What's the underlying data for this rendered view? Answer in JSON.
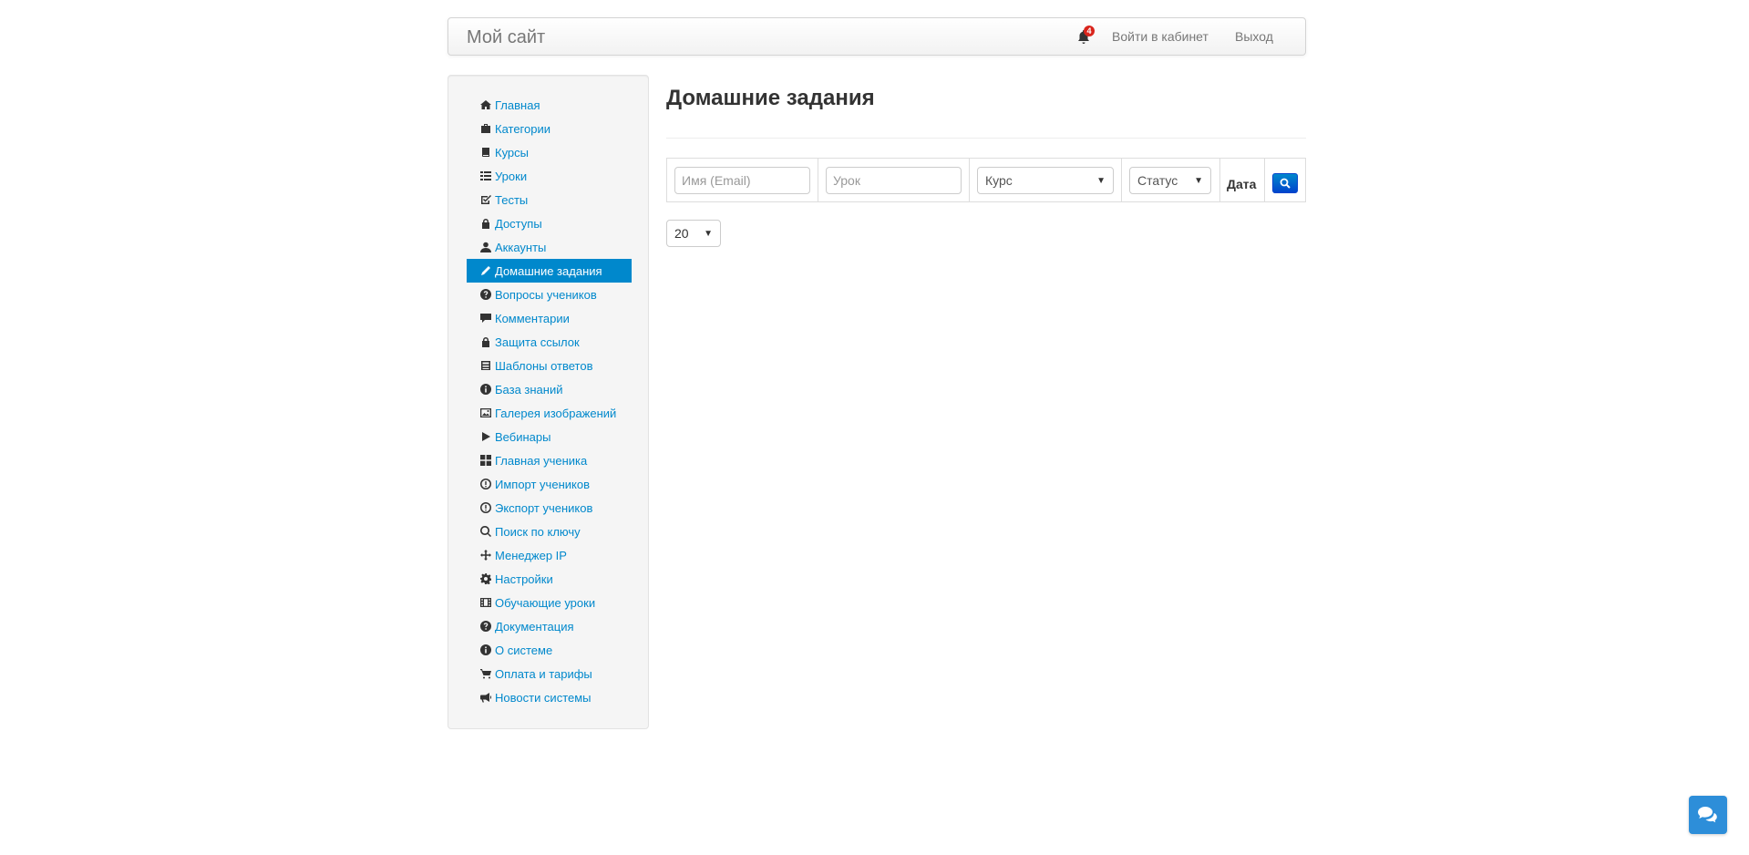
{
  "navbar": {
    "brand": "Мой сайт",
    "notifications_count": "4",
    "login_label": "Войти в кабинет",
    "logout_label": "Выход"
  },
  "sidebar": {
    "items": [
      {
        "label": "Главная",
        "icon": "home-icon"
      },
      {
        "label": "Категории",
        "icon": "briefcase-icon"
      },
      {
        "label": "Курсы",
        "icon": "book-icon"
      },
      {
        "label": "Уроки",
        "icon": "list-icon"
      },
      {
        "label": "Тесты",
        "icon": "check-square-icon"
      },
      {
        "label": "Доступы",
        "icon": "lock-icon"
      },
      {
        "label": "Аккаунты",
        "icon": "user-icon"
      },
      {
        "label": "Домашние задания",
        "icon": "pencil-icon",
        "active": true
      },
      {
        "label": "Вопросы учеников",
        "icon": "question-circle-icon"
      },
      {
        "label": "Комментарии",
        "icon": "comment-icon"
      },
      {
        "label": "Защита ссылок",
        "icon": "lock-icon"
      },
      {
        "label": "Шаблоны ответов",
        "icon": "template-icon"
      },
      {
        "label": "База знаний",
        "icon": "info-circle-icon"
      },
      {
        "label": "Галерея изображений",
        "icon": "picture-icon"
      },
      {
        "label": "Вебинары",
        "icon": "play-icon"
      },
      {
        "label": "Главная ученика",
        "icon": "th-large-icon"
      },
      {
        "label": "Импорт учеников",
        "icon": "import-icon"
      },
      {
        "label": "Экспорт учеников",
        "icon": "export-icon"
      },
      {
        "label": "Поиск по ключу",
        "icon": "search-icon"
      },
      {
        "label": "Менеджер IP",
        "icon": "move-icon"
      },
      {
        "label": "Настройки",
        "icon": "cog-icon"
      },
      {
        "label": "Обучающие уроки",
        "icon": "film-icon"
      },
      {
        "label": "Документация",
        "icon": "question-circle-icon"
      },
      {
        "label": "О системе",
        "icon": "info-circle-icon"
      },
      {
        "label": "Оплата и тарифы",
        "icon": "shopping-cart-icon"
      },
      {
        "label": "Новости системы",
        "icon": "bullhorn-icon"
      }
    ]
  },
  "main": {
    "title": "Домашние задания",
    "filters": {
      "name_placeholder": "Имя (Email)",
      "lesson_placeholder": "Урок",
      "course_selected": "Курс",
      "status_selected": "Статус",
      "date_label": "Дата"
    },
    "per_page": "20"
  },
  "colors": {
    "accent": "#0088cc",
    "badge": "#d9251c",
    "chat_button": "#2d8ed9"
  }
}
